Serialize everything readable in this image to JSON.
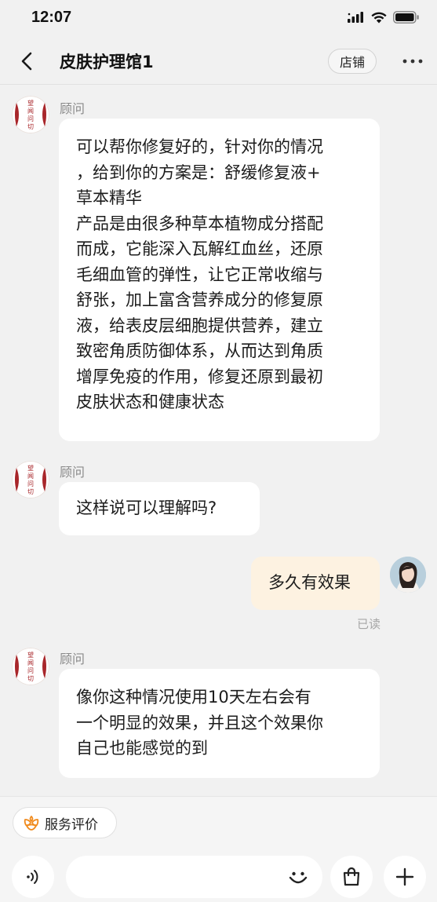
{
  "status_bar": {
    "time": "12:07",
    "icons": [
      "signal-icon",
      "wifi-icon",
      "battery-icon"
    ]
  },
  "nav": {
    "back_icon": "chevron-left-icon",
    "title": "皮肤护理馆1",
    "shop_label": "店铺",
    "more_icon": "more-dots-icon"
  },
  "messages": [
    {
      "direction": "in",
      "sender": "顾问",
      "text": "可以帮你修复好的，针对你的情况\n，给到你的方案是：舒缓修复液+\n草本精华\n产品是由很多种草本植物成分搭配\n而成，它能深入瓦解红血丝，还原\n毛细血管的弹性，让它正常收缩与\n舒张，加上富含营养成分的修复原\n液，给表皮层细胞提供营养，建立\n致密角质防御体系，从而达到角质\n增厚免疫的作用，修复还原到最初\n皮肤状态和健康状态"
    },
    {
      "direction": "in",
      "sender": "顾问",
      "text": "这样说可以理解吗?"
    },
    {
      "direction": "out",
      "text": "多久有效果",
      "status": "已读"
    },
    {
      "direction": "in",
      "sender": "顾问",
      "text": "像你这种情况使用10天左右会有\n一个明显的效果，并且这个效果你\n自己也能感觉的到"
    }
  ],
  "shop_avatar": {
    "chars": [
      "望",
      "闻",
      "问",
      "切"
    ],
    "color": "#a8262a"
  },
  "bottom": {
    "rating_label": "服务评价",
    "rating_icon": "flower-icon",
    "voice_icon": "voice-icon",
    "emoji_icon": "smile-icon",
    "bag_icon": "shopping-bag-icon",
    "plus_icon": "plus-icon",
    "input_value": ""
  },
  "colors": {
    "background": "#f1f1f1",
    "incoming_bubble": "#ffffff",
    "outgoing_bubble": "#fdf2e1",
    "accent_orange": "#f08a1c"
  }
}
